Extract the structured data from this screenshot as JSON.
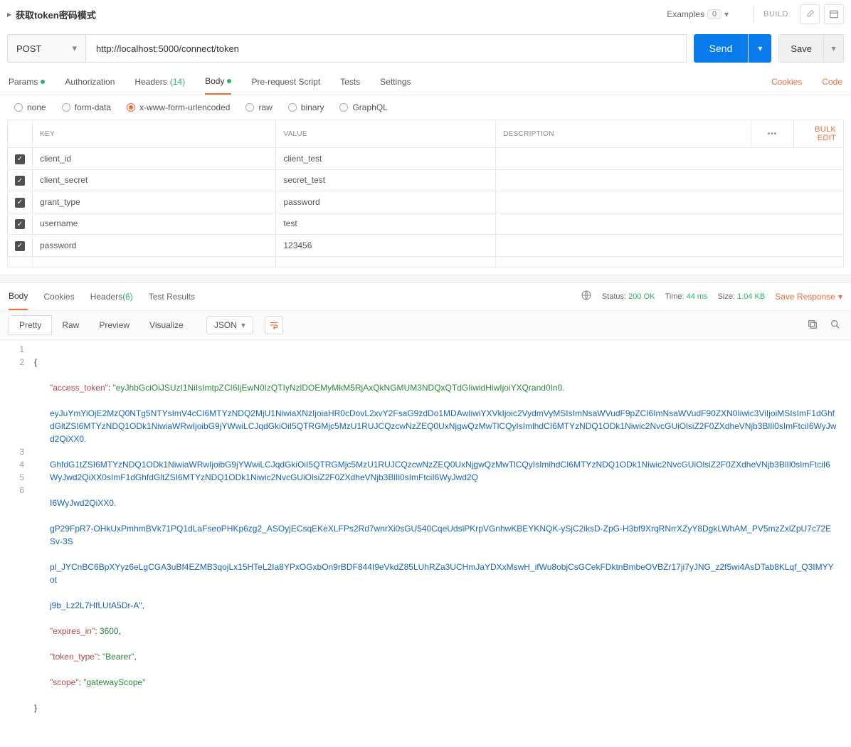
{
  "titlebar": {
    "title": "获取token密码模式",
    "examples_label": "Examples",
    "examples_count": "0",
    "build_label": "BUILD"
  },
  "request": {
    "method": "POST",
    "url": "http://localhost:5000/connect/token",
    "send_label": "Send",
    "save_label": "Save"
  },
  "req_tabs": {
    "params": "Params",
    "authorization": "Authorization",
    "headers": "Headers",
    "headers_count": "(14)",
    "body": "Body",
    "prerequest": "Pre-request Script",
    "tests": "Tests",
    "settings": "Settings",
    "cookies": "Cookies",
    "code": "Code"
  },
  "body_type": {
    "none": "none",
    "formdata": "form-data",
    "urlencoded": "x-www-form-urlencoded",
    "raw": "raw",
    "binary": "binary",
    "graphql": "GraphQL"
  },
  "kv_headers": {
    "key": "KEY",
    "value": "VALUE",
    "description": "DESCRIPTION",
    "bulk": "Bulk Edit"
  },
  "kv_rows": [
    {
      "key": "client_id",
      "value": "client_test"
    },
    {
      "key": "client_secret",
      "value": "secret_test"
    },
    {
      "key": "grant_type",
      "value": "password"
    },
    {
      "key": "username",
      "value": "test"
    },
    {
      "key": "password",
      "value": "123456"
    }
  ],
  "resp_tabs": {
    "body": "Body",
    "cookies": "Cookies",
    "headers": "Headers",
    "headers_count": "(6)",
    "tests": "Test Results"
  },
  "resp_meta": {
    "status_label": "Status:",
    "status_value": "200 OK",
    "time_label": "Time:",
    "time_value": "44 ms",
    "size_label": "Size:",
    "size_value": "1.04 KB",
    "save_response": "Save Response"
  },
  "viewer": {
    "pretty": "Pretty",
    "raw": "Raw",
    "preview": "Preview",
    "visualize": "Visualize",
    "format": "JSON"
  },
  "response_json": {
    "access_token_key": "\"access_token\"",
    "access_token_prefix": "\"eyJhbGciOiJSUzI1NiIsImtpZCI6IjEwN0IzQTIyNzlDOEMyMkM5RjAxQkNGMUM3NDQxQTdGIiwidHlwIjoiYXQrand0In0.",
    "access_token_body": "eyJuYmYiOjE2MzQ0NTg5NTYsImV4cCI6MTYzNDQ2MjU1NiwiaXNzIjoiaHR0cDovL2xvY2FsaG9zdDo1MDAwIiwiYXVkIjoic2VydmVyMSIsImNsaWVudF9pZCI6ImNsaWVudF90ZXN0Iiwic3ViIjoiMSIsImF1dGhfdGltZSI6MTYzNDQ1ODk1NiwiaWRwIjoibG9jYWwiLCJqdGkiOiI5QTRGMjc5MzU1RUJCQzcwNzZEQ0UxNjgwQzMwTlCQyIsImlhdCI6MTYzNDQ1ODk1Niwic2NvcGUiOlsiZ2F0ZXdheVNjb3BlIl0sImFtciI6WyJwd2QiXX0.",
    "access_token_body2": "GhfdG1tZSI6MTYzNDQ1ODk1NiwiaWRwIjoibG9jYWwiLCJqdGkiOiI5QTRGMjc5MzU1RUJCQzcwNzZEQ0UxNjgwQzMwTlCQyIsImlhdCI6MTYzNDQ1ODk1Niwic2NvcGUiOlsiZ2F0ZXdheVNjb3BlIl0sImFtciI6WyJwd2QiXX0sImF1dGhfdGltZSI6MTYzNDQ1ODk1Niwic2NvcGUiOlsiZ2F0ZXdheVNjb3BlIl0sImFtciI6WyJwd2Q",
    "access_token_sig1": "I6WyJwd2QiXX0.",
    "access_token_sig2": "gP29FpR7-OHkUxPmhmBVk71PQ1dLaFseoPHKp6zg2_ASOyjECsqEKeXLFPs2Rd7wnrXi0sGU540CqeUdslPKrpVGnhwKBEYKNQK-ySjC2iksD-ZpG-H3bf9XrqRNrrXZyY8DgkLWhAM_PV5mzZxlZpU7c72ESv-3S",
    "access_token_sig3": "pl_JYCnBC6BpXYyz6eLgCGA3uBf4EZMB3qojLx15HTeL2Ia8YPxOGxbOn9rBDF844I9eVkdZ85LUhRZa3UCHmJaYDXxMswH_ifWu8objCsGCekFDktnBmbeOVBZr17ji7yJNG_z2f5wi4AsDTab8KLqf_Q3IMYYot",
    "access_token_sig4": "j9b_Lz2L7HfLUtA5Dr-A\",",
    "expires_in_key": "\"expires_in\"",
    "expires_in_val": "3600",
    "token_type_key": "\"token_type\"",
    "token_type_val": "\"Bearer\"",
    "scope_key": "\"scope\"",
    "scope_val": "\"gatewayScope\""
  }
}
